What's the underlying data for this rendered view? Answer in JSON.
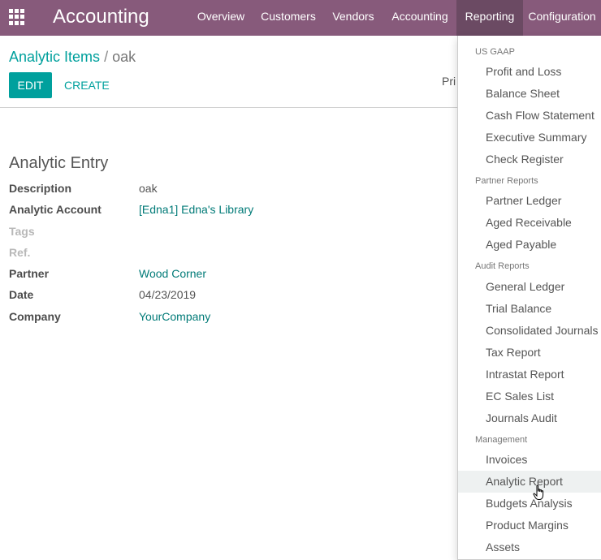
{
  "navbar": {
    "brand": "Accounting",
    "items": [
      "Overview",
      "Customers",
      "Vendors",
      "Accounting",
      "Reporting",
      "Configuration"
    ],
    "active": "Reporting",
    "color": "#875a7b"
  },
  "breadcrumb": {
    "parent": "Analytic Items",
    "separator": "/",
    "current": "oak"
  },
  "buttons": {
    "edit": "EDIT",
    "create": "CREATE"
  },
  "print_label": "Pri",
  "form": {
    "title": "Analytic Entry",
    "fields": [
      {
        "label": "Description",
        "value": "oak"
      },
      {
        "label": "Analytic Account",
        "value": "[Edna1] Edna's Library"
      },
      {
        "label": "Tags",
        "value": ""
      },
      {
        "label": "Ref.",
        "value": ""
      },
      {
        "label": "Partner",
        "value": "Wood Corner"
      },
      {
        "label": "Date",
        "value": "04/23/2019"
      },
      {
        "label": "Company",
        "value": "YourCompany"
      }
    ]
  },
  "reporting_menu": {
    "sections": [
      {
        "header": "US GAAP",
        "items": [
          "Profit and Loss",
          "Balance Sheet",
          "Cash Flow Statement",
          "Executive Summary",
          "Check Register"
        ]
      },
      {
        "header": "Partner Reports",
        "items": [
          "Partner Ledger",
          "Aged Receivable",
          "Aged Payable"
        ]
      },
      {
        "header": "Audit Reports",
        "items": [
          "General Ledger",
          "Trial Balance",
          "Consolidated Journals",
          "Tax Report",
          "Intrastat Report",
          "EC Sales List",
          "Journals Audit"
        ]
      },
      {
        "header": "Management",
        "items": [
          "Invoices",
          "Analytic Report",
          "Budgets Analysis",
          "Product Margins",
          "Assets"
        ]
      }
    ],
    "hovered": "Analytic Report"
  },
  "colors": {
    "accent": "#00a09d",
    "link": "#007a77",
    "navbar": "#875a7b"
  }
}
